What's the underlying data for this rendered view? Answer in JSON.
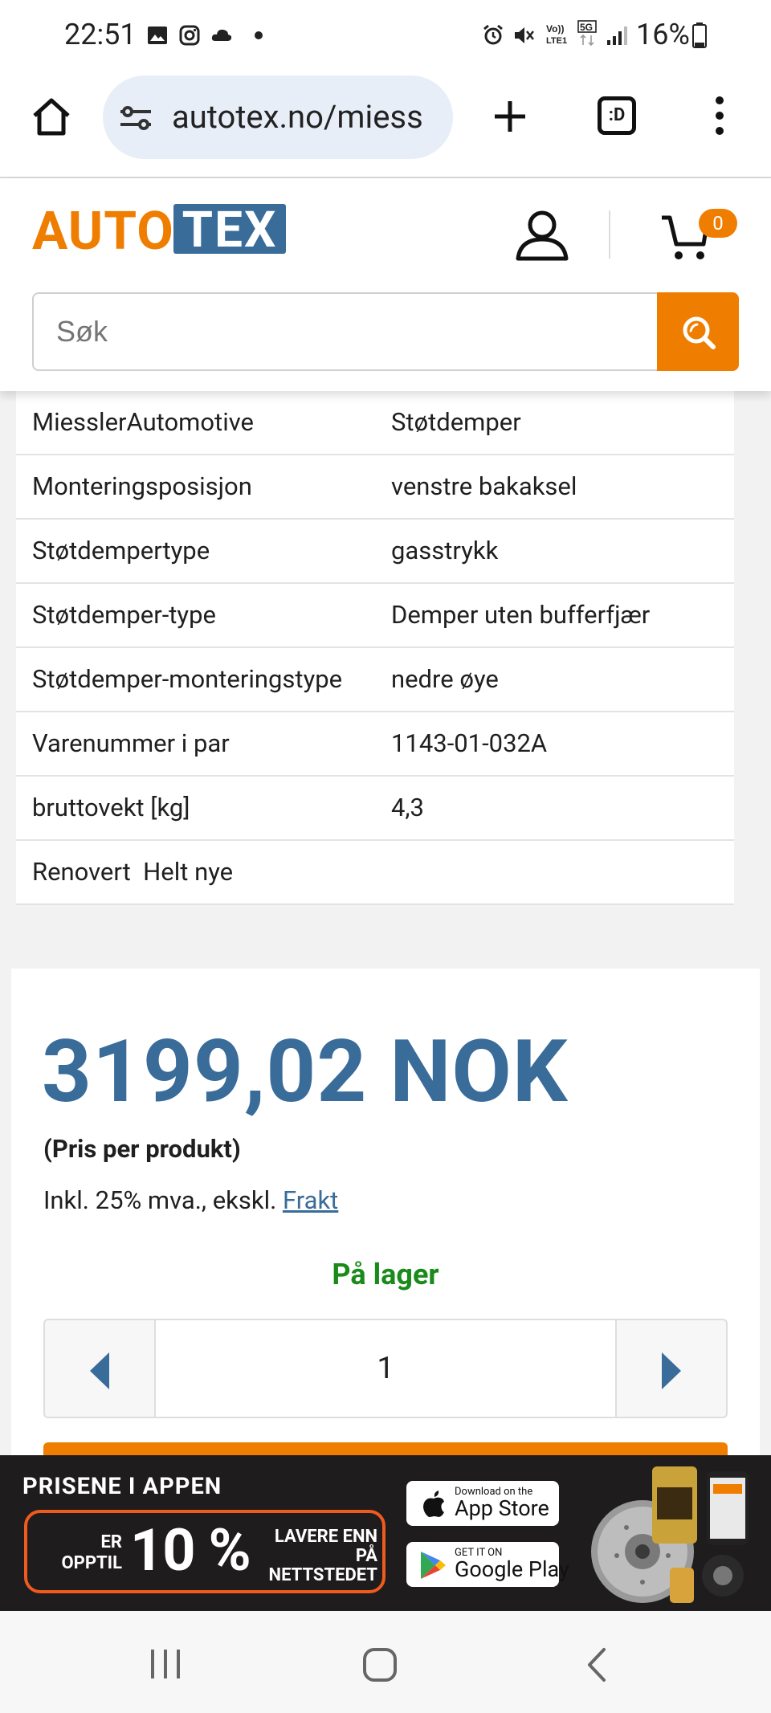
{
  "status_bar": {
    "time": "22:51",
    "battery": "16%",
    "icons": [
      "gallery-icon",
      "instagram-icon",
      "cloud-icon",
      "dot-icon",
      "alarm-icon",
      "mute-icon",
      "volte-icon",
      "5g-icon",
      "signal-icon",
      "battery-icon"
    ]
  },
  "browser": {
    "url": "autotex.no/miess",
    "tab_count": ":D"
  },
  "site": {
    "logo_auto": "AUTO",
    "logo_tex": "TEX",
    "cart_count": "0",
    "search_placeholder": "Søk"
  },
  "specs": [
    {
      "key": "MiesslerAutomotive",
      "value": "Støtdemper"
    },
    {
      "key": "Monteringsposisjon",
      "value": "venstre bakaksel"
    },
    {
      "key": "Støtdempertype",
      "value": "gasstrykk"
    },
    {
      "key": "Støtdemper-type",
      "value": "Demper uten bufferfjær"
    },
    {
      "key": "Støtdemper-monteringstype",
      "value": "nedre øye"
    },
    {
      "key": "Varenummer i par",
      "value": "1143-01-032A"
    },
    {
      "key": "bruttovekt [kg]",
      "value": "4,3"
    },
    {
      "key": "Renovert  Helt nye",
      "value": ""
    }
  ],
  "product": {
    "price": "3199,02 NOK",
    "price_note": "(Pris per produkt)",
    "vat_text": "Inkl. 25% mva., ekskl. ",
    "shipping_link": "Frakt",
    "stock_status": "På lager",
    "quantity": "1"
  },
  "banner": {
    "title": "PRISENE I APPEN",
    "er_opptil": "ER OPPTIL",
    "discount": "10 %",
    "lavere": "LAVERE ENN PÅ NETTSTEDET",
    "appstore_small": "Download on the",
    "appstore_big": "App Store",
    "googleplay_small": "GET IT ON",
    "googleplay_big": "Google Play"
  },
  "colors": {
    "brand_orange": "#ef7d00",
    "brand_blue": "#3a6c9a",
    "stock_green": "#1a8a1a"
  }
}
